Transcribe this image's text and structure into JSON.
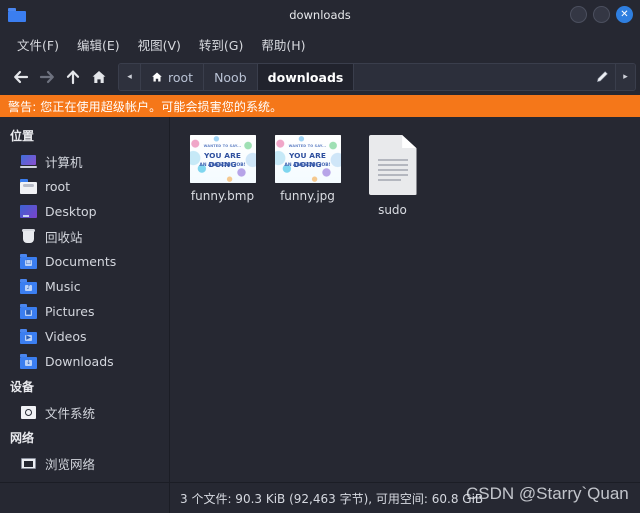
{
  "window": {
    "title": "downloads",
    "folder_icon": "folder-icon",
    "buttons": {
      "minimize": "",
      "maximize": "",
      "close": "✕"
    }
  },
  "menubar": {
    "items": [
      {
        "label": "文件(F)",
        "name": "menu-file"
      },
      {
        "label": "编辑(E)",
        "name": "menu-edit"
      },
      {
        "label": "视图(V)",
        "name": "menu-view"
      },
      {
        "label": "转到(G)",
        "name": "menu-go"
      },
      {
        "label": "帮助(H)",
        "name": "menu-help"
      }
    ]
  },
  "toolbar": {
    "back": "back-icon",
    "forward": "forward-icon",
    "up": "up-icon",
    "home": "home-icon",
    "scroll_left": "◂",
    "scroll_right": "▸",
    "edit_path": "pencil-icon",
    "breadcrumbs": [
      {
        "label": "root",
        "has_home_icon": true,
        "active": false
      },
      {
        "label": "Noob",
        "has_home_icon": false,
        "active": false
      },
      {
        "label": "downloads",
        "has_home_icon": false,
        "active": true
      }
    ]
  },
  "warning": {
    "text": "警告: 您正在使用超级帐户。可能会损害您的系统。",
    "background": "#f57719",
    "color": "#ffffff"
  },
  "sidebar": {
    "sections": [
      {
        "header": "位置",
        "items": [
          {
            "label": "计算机",
            "icon": "computer-icon"
          },
          {
            "label": "root",
            "icon": "home-folder-icon"
          },
          {
            "label": "Desktop",
            "icon": "desktop-icon"
          },
          {
            "label": "回收站",
            "icon": "trash-icon"
          },
          {
            "label": "Documents",
            "icon": "documents-folder-icon"
          },
          {
            "label": "Music",
            "icon": "music-folder-icon"
          },
          {
            "label": "Pictures",
            "icon": "pictures-folder-icon"
          },
          {
            "label": "Videos",
            "icon": "videos-folder-icon"
          },
          {
            "label": "Downloads",
            "icon": "downloads-folder-icon"
          }
        ]
      },
      {
        "header": "设备",
        "items": [
          {
            "label": "文件系统",
            "icon": "disk-icon"
          }
        ]
      },
      {
        "header": "网络",
        "items": [
          {
            "label": "浏览网络",
            "icon": "network-icon"
          }
        ]
      }
    ]
  },
  "files": [
    {
      "name": "funny.bmp",
      "kind": "image-thumbnail",
      "thumb_line1": "WANTED TO SAY...",
      "thumb_line2": "YOU ARE DOING",
      "thumb_line3": "AN AWESOME JOB!"
    },
    {
      "name": "funny.jpg",
      "kind": "image-thumbnail",
      "thumb_line1": "WANTED TO SAY...",
      "thumb_line2": "YOU ARE DOING",
      "thumb_line3": "AN AWESOME JOB!"
    },
    {
      "name": "sudo",
      "kind": "document-icon",
      "thumb_line1": "",
      "thumb_line2": "",
      "thumb_line3": ""
    }
  ],
  "statusbar": {
    "text": "3 个文件: 90.3 KiB (92,463 字节), 可用空间: 60.8 GiB"
  },
  "watermark": {
    "text": "CSDN @Starry`Quan"
  }
}
